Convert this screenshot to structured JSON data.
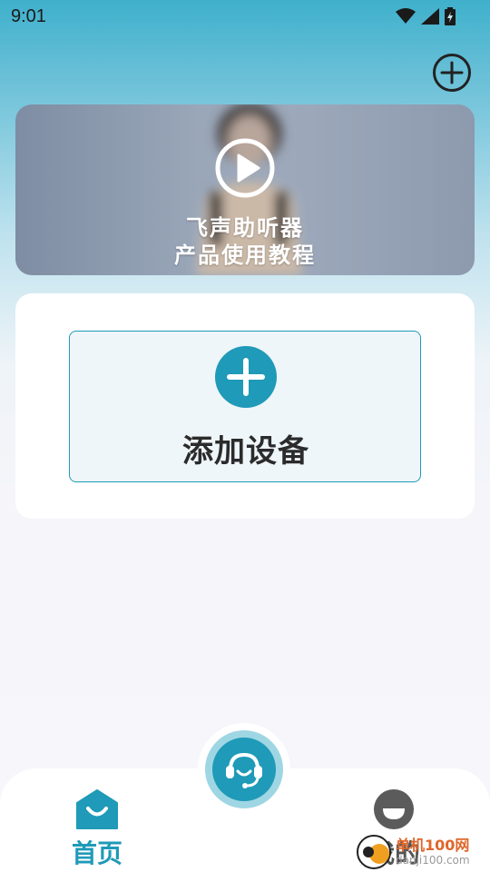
{
  "status_bar": {
    "time": "9:01",
    "icons": [
      "wifi-icon",
      "signal-icon",
      "battery-charging-icon"
    ]
  },
  "header": {
    "add_icon": "plus-circle-icon"
  },
  "banner": {
    "line1": "飞声助听器",
    "line2": "产品使用教程",
    "icon": "play-icon"
  },
  "device_card": {
    "add_label": "添加设备",
    "icon": "plus-circle-filled-icon"
  },
  "tab_bar": {
    "home_label": "首页",
    "mine_label": "我的",
    "center_icon": "headset-icon"
  },
  "watermark": {
    "main": "单机100网",
    "sub": "danji100.com"
  },
  "colors": {
    "accent": "#1f9ab8",
    "accent_light": "#9fd6e3",
    "text_dark": "#2b2b2b",
    "watermark_orange": "#e0662a"
  }
}
